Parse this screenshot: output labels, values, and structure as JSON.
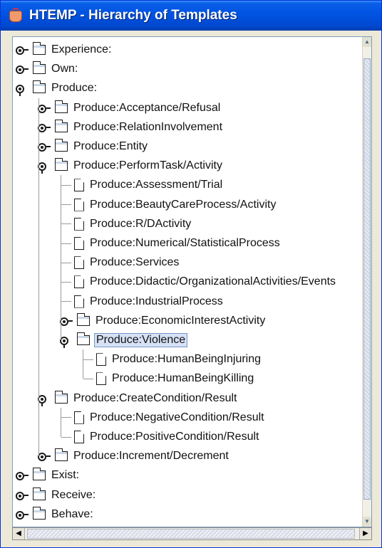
{
  "window": {
    "title": "HTEMP - Hierarchy of Templates",
    "title_bar_color": "#0054e3"
  },
  "tree": {
    "items": [
      {
        "label": "Experience:",
        "type": "folder",
        "state": "collapsed",
        "depth": 0
      },
      {
        "label": "Own:",
        "type": "folder",
        "state": "collapsed",
        "depth": 0
      },
      {
        "label": "Produce:",
        "type": "folder",
        "state": "expanded",
        "depth": 0
      },
      {
        "label": "Produce:Acceptance/Refusal",
        "type": "folder",
        "state": "collapsed",
        "depth": 1
      },
      {
        "label": "Produce:RelationInvolvement",
        "type": "folder",
        "state": "collapsed",
        "depth": 1
      },
      {
        "label": "Produce:Entity",
        "type": "folder",
        "state": "collapsed",
        "depth": 1
      },
      {
        "label": "Produce:PerformTask/Activity",
        "type": "folder",
        "state": "expanded",
        "depth": 1
      },
      {
        "label": "Produce:Assessment/Trial",
        "type": "leaf",
        "depth": 2
      },
      {
        "label": "Produce:BeautyCareProcess/Activity",
        "type": "leaf",
        "depth": 2
      },
      {
        "label": "Produce:R/DActivity",
        "type": "leaf",
        "depth": 2
      },
      {
        "label": "Produce:Numerical/StatisticalProcess",
        "type": "leaf",
        "depth": 2
      },
      {
        "label": "Produce:Services",
        "type": "leaf",
        "depth": 2
      },
      {
        "label": "Produce:Didactic/OrganizationalActivities/Events",
        "type": "leaf",
        "depth": 2
      },
      {
        "label": "Produce:IndustrialProcess",
        "type": "leaf",
        "depth": 2
      },
      {
        "label": "Produce:EconomicInterestActivity",
        "type": "folder",
        "state": "collapsed",
        "depth": 2
      },
      {
        "label": "Produce:Violence",
        "type": "folder",
        "state": "expanded",
        "depth": 2,
        "selected": true
      },
      {
        "label": "Produce:HumanBeingInjuring",
        "type": "leaf",
        "depth": 3
      },
      {
        "label": "Produce:HumanBeingKilling",
        "type": "leaf",
        "depth": 3
      },
      {
        "label": "Produce:CreateCondition/Result",
        "type": "folder",
        "state": "expanded",
        "depth": 1
      },
      {
        "label": "Produce:NegativeCondition/Result",
        "type": "leaf",
        "depth": 2
      },
      {
        "label": "Produce:PositiveCondition/Result",
        "type": "leaf",
        "depth": 2
      },
      {
        "label": "Produce:Increment/Decrement",
        "type": "folder",
        "state": "collapsed",
        "depth": 1
      },
      {
        "label": "Exist:",
        "type": "folder",
        "state": "collapsed",
        "depth": 0
      },
      {
        "label": "Receive:",
        "type": "folder",
        "state": "collapsed",
        "depth": 0
      },
      {
        "label": "Behave:",
        "type": "folder",
        "state": "collapsed",
        "depth": 0
      }
    ]
  },
  "colors": {
    "selection_bg": "#d6e1f5",
    "selection_border": "#7a96c8"
  }
}
